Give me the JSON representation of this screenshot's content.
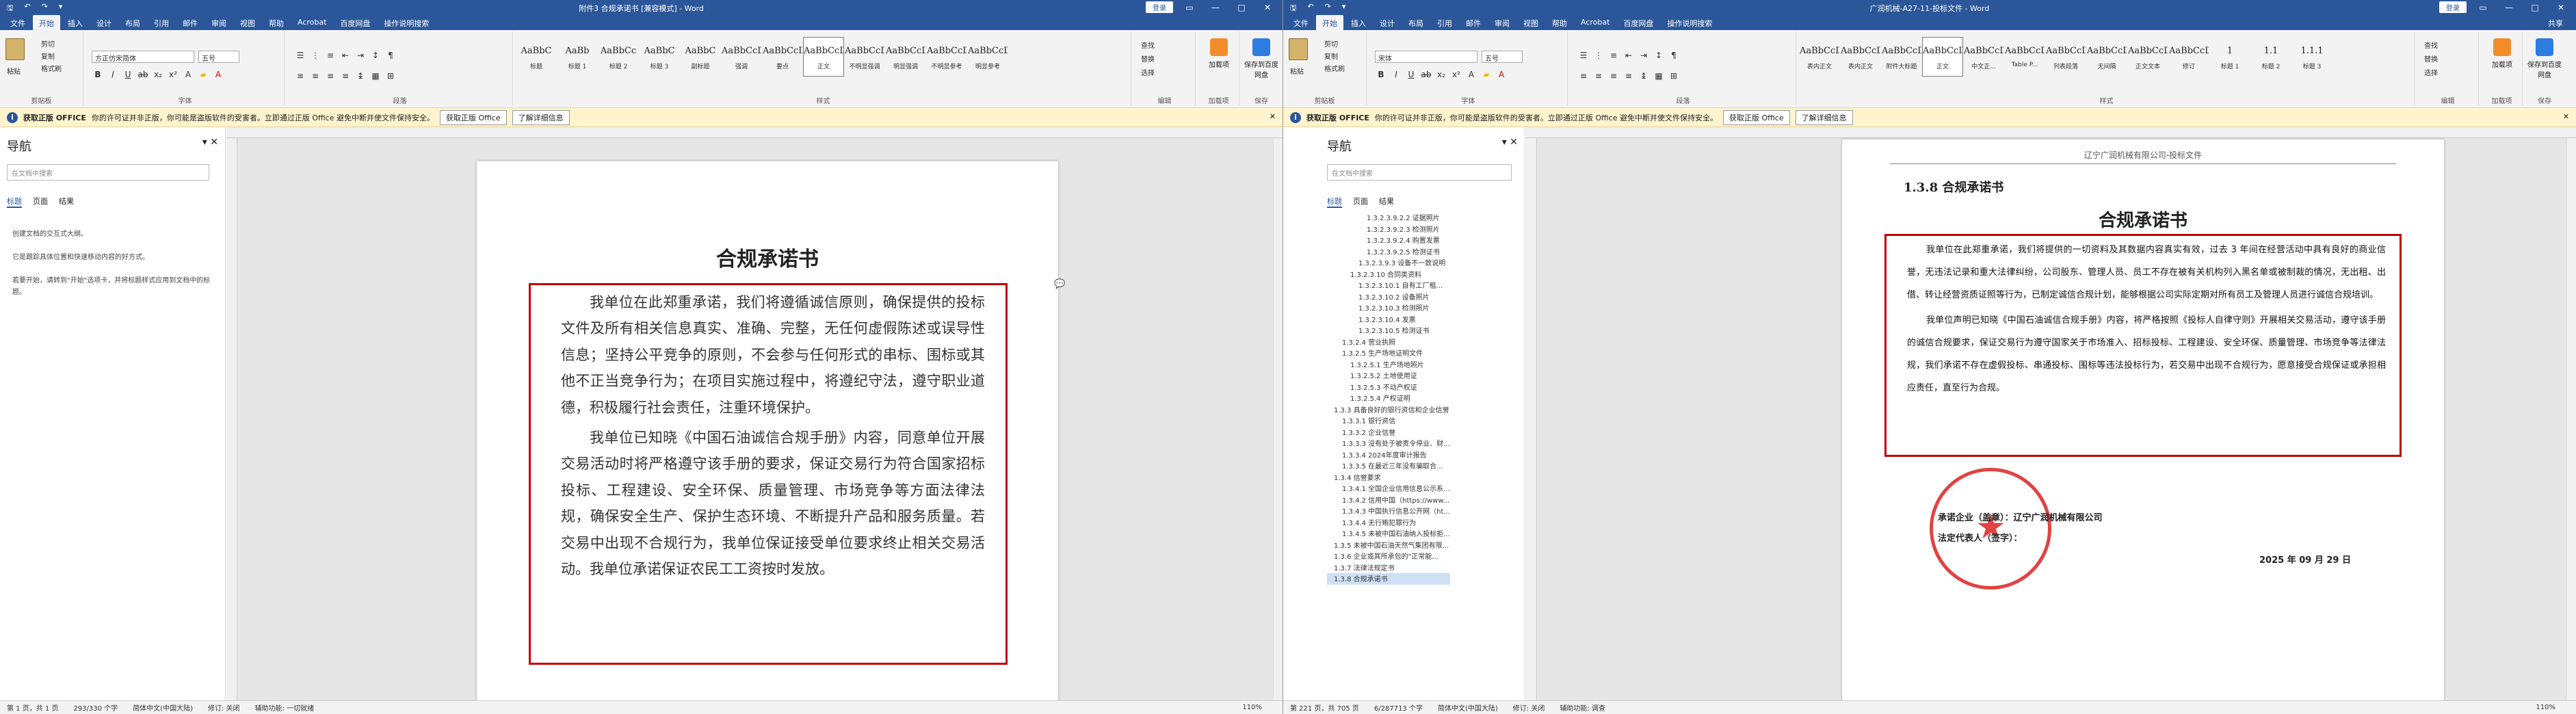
{
  "win1": {
    "title": "附件3 合规承诺书 [兼容模式] - Word",
    "login": "登录",
    "tabs": [
      "文件",
      "开始",
      "插入",
      "设计",
      "布局",
      "引用",
      "邮件",
      "审阅",
      "视图",
      "帮助",
      "Acrobat",
      "百度网盘",
      "操作说明搜索"
    ],
    "clipboard": {
      "paste": "粘贴",
      "cut": "剪切",
      "copy": "复制",
      "painter": "格式刷",
      "label": "剪贴板"
    },
    "font": {
      "name": "方正仿宋简体",
      "size": "五号",
      "label": "字体"
    },
    "paragraph_label": "段落",
    "styles_label": "样式",
    "styles": [
      {
        "pv": "AaBbC",
        "nm": "标题"
      },
      {
        "pv": "AaBb",
        "nm": "标题 1"
      },
      {
        "pv": "AaBbCc",
        "nm": "标题 2"
      },
      {
        "pv": "AaBbC",
        "nm": "标题 3"
      },
      {
        "pv": "AaBbC",
        "nm": "副标题"
      },
      {
        "pv": "AaBbCcD",
        "nm": "强调"
      },
      {
        "pv": "AaBbCcD",
        "nm": "要点"
      },
      {
        "pv": "AaBbCcDd",
        "nm": "正文"
      },
      {
        "pv": "AaBbCcDd",
        "nm": "不明显强调"
      },
      {
        "pv": "AaBbCcDd",
        "nm": "明显强调"
      },
      {
        "pv": "AaBbCcDd",
        "nm": "不明显参考"
      },
      {
        "pv": "AaBbCcD",
        "nm": "明显参考"
      }
    ],
    "edit": {
      "find": "查找",
      "replace": "替换",
      "select": "选择",
      "label": "编辑"
    },
    "addin": {
      "btn": "加载项",
      "label": "加载项"
    },
    "save": {
      "btn": "保存到百度网盘",
      "label": "保存"
    },
    "msg": {
      "title": "获取正版 OFFICE",
      "text": "你的许可证并非正版，你可能是盗版软件的受害者。立即通过正版 Office 避免中断并使文件保持安全。",
      "btn1": "获取正版 Office",
      "btn2": "了解详细信息"
    },
    "nav": {
      "title": "导航",
      "search": "在文档中搜索",
      "tabs": [
        "标题",
        "页面",
        "结果"
      ],
      "text": [
        "创建文档的交互式大纲。",
        "它是跟踪具体位置和快速移动内容的好方式。",
        "若要开始，请转到\"开始\"选项卡，并将标题样式应用到文档中的标题。"
      ]
    },
    "doc": {
      "title": "合规承诺书",
      "paragraphs": [
        "我单位在此郑重承诺，我们将遵循诚信原则，确保提供的投标文件及所有相关信息真实、准确、完整，无任何虚假陈述或误导性信息；坚持公平竞争的原则，不会参与任何形式的串标、围标或其他不正当竞争行为；在项目实施过程中，将遵纪守法，遵守职业道德，积极履行社会责任，注重环境保护。",
        "我单位已知晓《中国石油诚信合规手册》内容，同意单位开展交易活动时将严格遵守该手册的要求，保证交易行为符合国家招标投标、工程建设、安全环保、质量管理、市场竞争等方面法律法规，确保安全生产、保护生态环境、不断提升产品和服务质量。若交易中出现不合规行为，我单位保证接受单位要求终止相关交易活动。我单位承诺保证农民工工资按时发放。"
      ]
    },
    "status": {
      "page": "第 1 页，共 1 页",
      "words": "293/330 个字",
      "lang": "简体中文(中国大陆)",
      "track": "修订: 关闭",
      "access": "辅助功能: 一切就绪",
      "zoom": "110%"
    }
  },
  "win2": {
    "title": "广润机械-A27-11-投标文件 - Word",
    "login": "登录",
    "share": "共享",
    "tabs": [
      "文件",
      "开始",
      "插入",
      "设计",
      "布局",
      "引用",
      "邮件",
      "审阅",
      "视图",
      "帮助",
      "Acrobat",
      "百度网盘",
      "操作说明搜索"
    ],
    "clipboard": {
      "paste": "粘贴",
      "cut": "剪切",
      "copy": "复制",
      "painter": "格式刷",
      "label": "剪贴板"
    },
    "font": {
      "name": "宋体",
      "size": "五号",
      "label": "字体"
    },
    "paragraph_label": "段落",
    "styles_label": "样式",
    "styles": [
      {
        "pv": "AaBbCcD",
        "nm": "表内正文"
      },
      {
        "pv": "AaBbCcDc",
        "nm": "表内正文"
      },
      {
        "pv": "AaBbCcD",
        "nm": "附件大标题"
      },
      {
        "pv": "AaBbCcD",
        "nm": "正文"
      },
      {
        "pv": "AaBbCcDc",
        "nm": "中文正..."
      },
      {
        "pv": "AaBbCcDc",
        "nm": "Table P..."
      },
      {
        "pv": "AaBbCcD",
        "nm": "列表段落"
      },
      {
        "pv": "AaBbCcD",
        "nm": "无间隔"
      },
      {
        "pv": "AaBbCcD",
        "nm": "正文文本"
      },
      {
        "pv": "AaBbCcD",
        "nm": "修订"
      },
      {
        "pv": "1",
        "nm": "标题 1"
      },
      {
        "pv": "1.1",
        "nm": "标题 2"
      },
      {
        "pv": "1.1.1",
        "nm": "标题 3"
      }
    ],
    "edit": {
      "find": "查找",
      "replace": "替换",
      "select": "选择",
      "label": "编辑"
    },
    "addin": {
      "btn": "加载项",
      "label": "加载项"
    },
    "save": {
      "btn": "保存到百度网盘",
      "label": "保存"
    },
    "msg": {
      "title": "获取正版 OFFICE",
      "text": "你的许可证并非正版，你可能是盗版软件的受害者。立即通过正版 Office 避免中断并使文件保持安全。",
      "btn1": "获取正版 Office",
      "btn2": "了解详细信息"
    },
    "nav": {
      "title": "导航",
      "search": "在文档中搜索",
      "tabs": [
        "标题",
        "页面",
        "结果"
      ],
      "headings": [
        "1.3.2.3.9.2.2 证据照片",
        "1.3.2.3.9.2.3 检测照片",
        "1.3.2.3.9.2.4 购置发票",
        "1.3.2.3.9.2.5 检测证书",
        "1.3.2.3.9.3 设备不一致说明",
        "1.3.2.3.10 合同类资料",
        "1.3.2.3.10.1 自有工厂租...",
        "1.3.2.3.10.2 设备照片",
        "1.3.2.3.10.3 检测照片",
        "1.3.2.3.10.4 发票",
        "1.3.2.3.10.5 检测证书",
        "1.3.2.4 营业执照",
        "1.3.2.5 生产场地证明文件",
        "1.3.2.5.1 生产场地照片",
        "1.3.2.5.2 土地使用证",
        "1.3.2.5.3 不动产权证",
        "1.3.2.5.4 产权证明",
        "1.3.3 具备良好的银行资信和企业信誉",
        "1.3.3.1 银行资信",
        "1.3.3.2 企业信誉",
        "1.3.3.3 没有处于被责令停业、财...",
        "1.3.3.4 2024年度审计报告",
        "1.3.3.5 在最近三年没有骗取合...",
        "1.3.4 信誉要求",
        "1.3.4.1 全国企业信用信息公示系...",
        "1.3.4.2 信用中国（https://www...",
        "1.3.4.3 中国执行信息公开网（ht...",
        "1.3.4.4 无行贿犯罪行为",
        "1.3.4.5 未被中国石油纳入投标拒...",
        "1.3.5 未被中国石油天然气集团有限...",
        "1.3.6 企业或其所承包的\"正常能...",
        "1.3.7 法律法规定书",
        "1.3.8 合规承诺书"
      ]
    },
    "doc": {
      "header": "辽宁广润机械有限公司-投标文件",
      "heading": "1.3.8 合规承诺书",
      "title": "合规承诺书",
      "paragraphs": [
        "我单位在此郑重承诺，我们将提供的一切资料及其数据内容真实有效，过去 3 年间在经营活动中具有良好的商业信誉，无违法记录和重大法律纠纷，公司股东、管理人员、员工不存在被有关机构列入黑名单或被制裁的情况，无出租、出借、转让经营资质证照等行为，已制定诚信合规计划，能够根据公司实际定期对所有员工及管理人员进行诚信合规培训。",
        "我单位声明已知晓《中国石油诚信合规手册》内容，将严格按照《投标人自律守则》开展相关交易活动，遵守该手册的诚信合规要求，保证交易行为遵守国家关于市场准入、招标投标、工程建设、安全环保、质量管理、市场竞争等法律法规，我们承诺不存在虚假投标、串通投标、围标等违法投标行为，若交易中出现不合规行为，愿意接受合规保证或承担相应责任，直至行为合规。"
      ],
      "signer": "承诺企业（盖章）：辽宁广润机械有限公司",
      "legal": "法定代表人（签字）：",
      "date": "2025 年 09 月 29 日"
    },
    "status": {
      "page": "第 221 页，共 705 页",
      "words": "6/287713 个字",
      "lang": "简体中文(中国大陆)",
      "track": "修订: 关闭",
      "access": "辅助功能: 调查",
      "zoom": "110%"
    }
  }
}
